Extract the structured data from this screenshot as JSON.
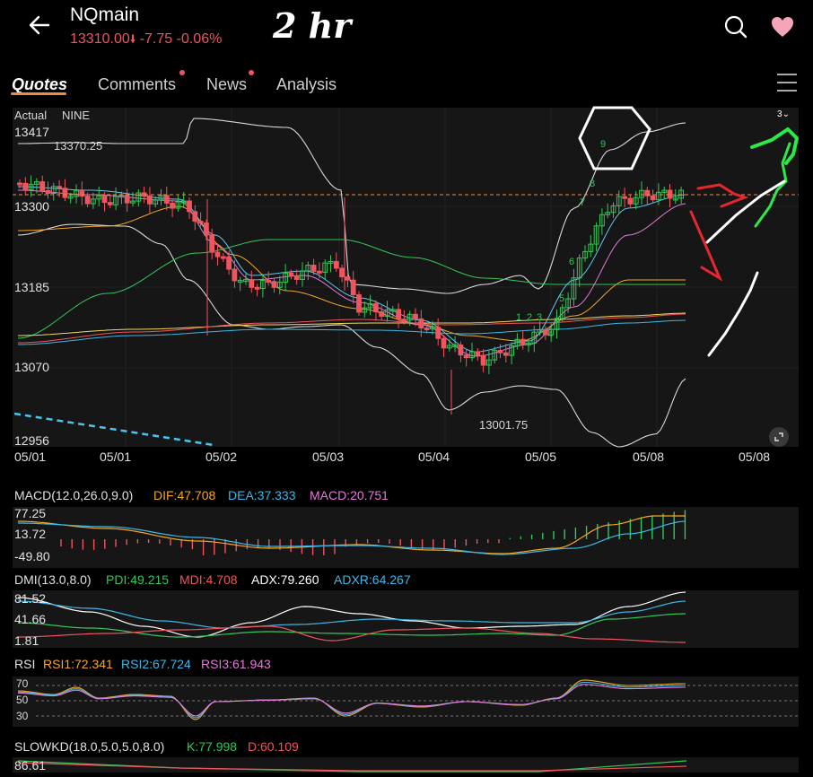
{
  "header": {
    "title": "NQmain",
    "price": "13310.00",
    "change": "-7.75",
    "change_pct": "-0.06%",
    "annotation": "2 hr"
  },
  "tabs": [
    {
      "label": "Quotes",
      "active": true
    },
    {
      "label": "Comments",
      "badge": true
    },
    {
      "label": "News",
      "badge": true
    },
    {
      "label": "Analysis"
    }
  ],
  "chart": {
    "overlay_labels": [
      "Actual",
      "NINE"
    ],
    "period_selector": "3",
    "price_axis": [
      "13417",
      "13300",
      "13185",
      "13070",
      "12956"
    ],
    "high_marker": "13370.25",
    "low_marker": "13001.75",
    "date_axis": [
      "05/01",
      "05/01",
      "05/02",
      "05/03",
      "05/04",
      "05/05",
      "05/08",
      "05/08"
    ],
    "td_counts_green": [
      "1",
      "2",
      "3",
      "4",
      "5",
      "6",
      "7",
      "8",
      "9"
    ]
  },
  "macd": {
    "name": "MACD(12.0,26.0,9.0)",
    "dif": "DIF:47.708",
    "dea": "DEA:37.333",
    "macd": "MACD:20.751",
    "axis": [
      "77.25",
      "13.72",
      "-49.80"
    ]
  },
  "dmi": {
    "name": "DMI(13.0,8.0)",
    "pdi": "PDI:49.215",
    "mdi": "MDI:4.708",
    "adx": "ADX:79.260",
    "adxr": "ADXR:64.267",
    "axis": [
      "81.52",
      "41.66",
      "1.81"
    ]
  },
  "rsi": {
    "name": "RSI",
    "rsi1": "RSI1:72.341",
    "rsi2": "RSI2:67.724",
    "rsi3": "RSI3:61.943",
    "axis": [
      "70",
      "50",
      "30"
    ]
  },
  "slowkd": {
    "name": "SLOWKD(18.0,5.0,5.0,8.0)",
    "k": "K:77.998",
    "d": "D:60.109",
    "axis": [
      "86.61"
    ]
  },
  "colors": {
    "up": "#34c759",
    "down": "#f0545e",
    "accent": "#f08a3c",
    "dif": "#f5a623",
    "dea": "#3cb8e8",
    "macd": "#e47ad9",
    "adx": "#ffffff"
  }
}
